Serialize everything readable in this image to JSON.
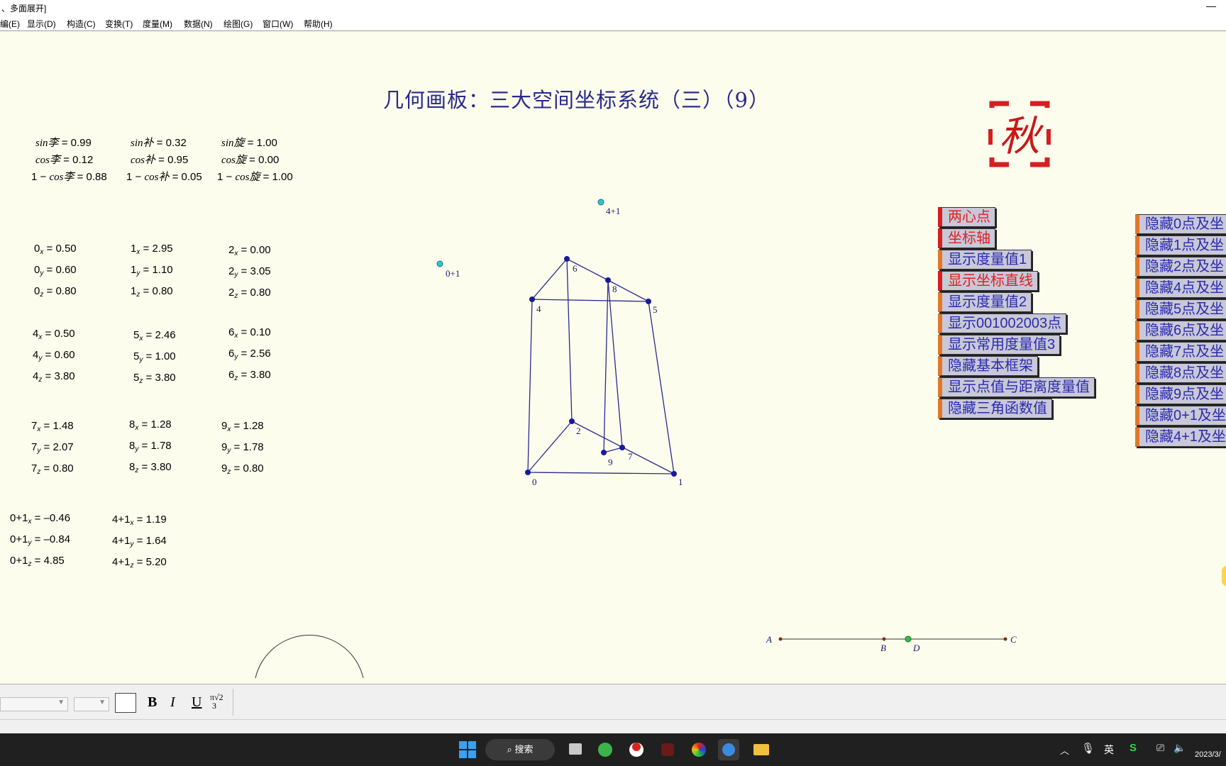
{
  "window": {
    "title": "、多面展开]"
  },
  "menu": [
    "编(E)",
    "显示(D)",
    "构造(C)",
    "变换(T)",
    "度量(M)",
    "数据(N)",
    "绘图(G)",
    "窗口(W)",
    "帮助(H)"
  ],
  "page_title": "几何画板：三大空间坐标系统（三）（9）",
  "logo_text": "秋",
  "trig": {
    "col1": [
      {
        "pre": "",
        "fn": "sin",
        "sym": "李",
        "val": " = 0.99"
      },
      {
        "pre": "",
        "fn": "cos",
        "sym": "李",
        "val": " = 0.12"
      },
      {
        "pre": "1 − ",
        "fn": "cos",
        "sym": "李",
        "val": " = 0.88"
      }
    ],
    "col2": [
      {
        "pre": "",
        "fn": "sin",
        "sym": "补",
        "val": " = 0.32"
      },
      {
        "pre": "",
        "fn": "cos",
        "sym": "补",
        "val": " = 0.95"
      },
      {
        "pre": "1 − ",
        "fn": "cos",
        "sym": "补",
        "val": " = 0.05"
      }
    ],
    "col3": [
      {
        "pre": "",
        "fn": "sin",
        "sym": "旋",
        "val": " = 1.00"
      },
      {
        "pre": "",
        "fn": "cos",
        "sym": "旋",
        "val": " = 0.00"
      },
      {
        "pre": "1 − ",
        "fn": "cos",
        "sym": "旋",
        "val": " = 1.00"
      }
    ]
  },
  "coords": [
    {
      "p": "0",
      "x": "0.50",
      "y": "0.60",
      "z": "0.80"
    },
    {
      "p": "1",
      "x": "2.95",
      "y": "1.10",
      "z": "0.80"
    },
    {
      "p": "2",
      "x": "0.00",
      "y": "3.05",
      "z": "0.80"
    },
    {
      "p": "4",
      "x": "0.50",
      "y": "0.60",
      "z": "3.80"
    },
    {
      "p": "5",
      "x": "2.46",
      "y": "1.00",
      "z": "3.80"
    },
    {
      "p": "6",
      "x": "0.10",
      "y": "2.56",
      "z": "3.80"
    },
    {
      "p": "7",
      "x": "1.48",
      "y": "2.07",
      "z": "0.80"
    },
    {
      "p": "8",
      "x": "1.28",
      "y": "1.78",
      "z": "3.80"
    },
    {
      "p": "9",
      "x": "1.28",
      "y": "1.78",
      "z": "0.80"
    },
    {
      "p": "0+1",
      "x": "–0.46",
      "y": "–0.84",
      "z": "4.85"
    },
    {
      "p": "4+1",
      "x": "1.19",
      "y": "1.64",
      "z": "5.20"
    }
  ],
  "axis_suffix": {
    "x": "x",
    "y": "y",
    "z": "z"
  },
  "figure": {
    "labels": [
      "0",
      "1",
      "2",
      "4",
      "5",
      "6",
      "7",
      "8",
      "9",
      "0+1",
      "4+1"
    ],
    "slider": [
      "A",
      "B",
      "D",
      "C"
    ]
  },
  "buttons_left": [
    {
      "label": "两心点",
      "color": "red"
    },
    {
      "label": "坐标轴",
      "color": "red"
    },
    {
      "label": "显示度量值1",
      "color": "blue"
    },
    {
      "label": "显示坐标直线",
      "color": "red"
    },
    {
      "label": "显示度量值2",
      "color": "blue"
    },
    {
      "label": "显示001002003点",
      "color": "blue"
    },
    {
      "label": "显示常用度量值3",
      "color": "blue"
    },
    {
      "label": "隐藏基本框架",
      "color": "blue"
    },
    {
      "label": "显示点值与距离度量值",
      "color": "blue"
    },
    {
      "label": "隐藏三角函数值",
      "color": "blue"
    }
  ],
  "buttons_right": [
    "隐藏0点及坐",
    "隐藏1点及坐",
    "隐藏2点及坐",
    "隐藏4点及坐",
    "隐藏5点及坐",
    "隐藏6点及坐",
    "隐藏7点及坐",
    "隐藏8点及坐",
    "隐藏9点及坐",
    "隐藏0+1及坐",
    "隐藏4+1及坐"
  ],
  "format_bar": {
    "bold": "B",
    "italic": "I",
    "underline": "U"
  },
  "taskbar": {
    "search": "搜索",
    "ime": "英",
    "clock": "2023/3/"
  },
  "colors": {
    "point": "#1a1a9c",
    "line": "#2a2a8c",
    "bg": "#fdfdee",
    "accent_orange": "#e0782a",
    "red": "#e02020"
  }
}
